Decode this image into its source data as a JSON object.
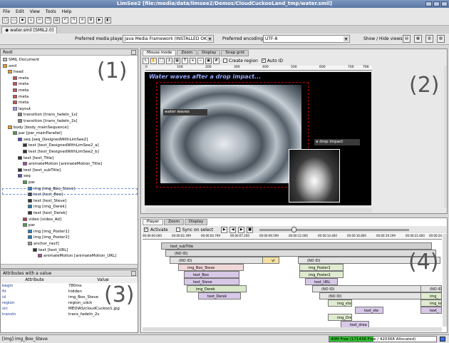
{
  "window": {
    "title": "LimSee2 [file:/media/data/limsee2/Demos/CloudCuckooLand_tmp/water.smil]"
  },
  "menu": [
    "File",
    "Edit",
    "View",
    "Tools",
    "Help"
  ],
  "toolbar_icons": [
    "new-icon",
    "open-icon",
    "save-icon",
    "saveas-icon",
    "cut-icon",
    "copy-icon",
    "paste-icon",
    "undo-icon",
    "redo-icon",
    "delete-icon",
    "settings-icon",
    "play-icon",
    "preview-icon"
  ],
  "document_tab": "water.smil [SMIL2.0]",
  "prefs": {
    "player_label": "Preferred media player:",
    "player_value": "Java Media Framework (INSTALLED OK)",
    "encoding_label": "Preferred encoding:",
    "encoding_value": "UTF-8",
    "views_label": "Show / Hide views:"
  },
  "tree": {
    "root_label": "Root",
    "rows": [
      "SMIL Document",
      "smil",
      "head",
      "meta",
      "meta",
      "meta",
      "meta",
      "meta",
      "layout",
      "transition [trans_fadeIn_1s]",
      "transition [trans_fadeIn_2s]",
      "body [body_mainSequence]",
      "par [par_mainParallel]",
      "seq [seq_DesignedWithLimSee2]",
      "text [text_DesignedWithLimSee2_a]",
      "text [text_DesignedWithLimSee2_b]",
      "text [text_Title]",
      "animateMotion [animateMotion_Title]",
      "text [text_subTitle]",
      "seq",
      "par",
      "img [img_Boo_Steve]",
      "text [text_Boo]",
      "text [text_Steve]",
      "img [img_Derek]",
      "text [text_Derek]",
      "video [video_Ad]",
      "par",
      "img [img_Poster1]",
      "img [img_Poster2]",
      "anchor_necf]",
      "text [text_URL]",
      "animateMotion [animateMotion_URL]"
    ]
  },
  "attributes": {
    "header": "Attributes with a value",
    "col_attr": "Attribute",
    "col_value": "Value",
    "rows": [
      {
        "k": "begin",
        "v": "780ms"
      },
      {
        "k": "fit",
        "v": "hidden"
      },
      {
        "k": "id",
        "v": "img_Boo_Steve"
      },
      {
        "k": "region",
        "v": "region_udck"
      },
      {
        "k": "src",
        "v": "MEDIAS/cloudCuckoo1.jpg"
      },
      {
        "k": "transIn",
        "v": "trans_fadeIn_2s"
      }
    ]
  },
  "layout_view": {
    "tabs": [
      "Mouse mode",
      "Zoom",
      "Display",
      "Snap grid"
    ],
    "create_region": "Create region",
    "auto_id": "Auto ID",
    "ruler": [
      "0",
      "100",
      "200",
      "300",
      "400",
      "500",
      "600",
      "700",
      "766"
    ],
    "title_text": "Water waves after a drop impact...",
    "label_water": "water waves",
    "label_drop": "a drop impact"
  },
  "timeline": {
    "tabs": [
      "Player",
      "Zoom",
      "Display"
    ],
    "activate": "Activate",
    "sync": "Sync on select",
    "ruler": [
      "00:00:00.000",
      "00:00:02.399",
      "00:00:04.799",
      "00:00:07.200",
      "00:00:09.599",
      "00:00:12.000",
      "00:00:14.400",
      "00:00:16.800",
      "00:00:19.199",
      "00:00:21.600",
      "00:00:24.0"
    ],
    "items": [
      {
        "label": "text_subTitle"
      },
      {
        "label": "(NO ID)"
      },
      {
        "label": "(NO ID)"
      },
      {
        "label": "img_Boo_Steve"
      },
      {
        "label": "text_Boo"
      },
      {
        "label": "text_Steve"
      },
      {
        "label": "img_Derek"
      },
      {
        "label": "text_Derek"
      },
      {
        "label": "vi"
      },
      {
        "label": "(NO ID)"
      },
      {
        "label": "img_Poster1"
      },
      {
        "label": "img_Poster2"
      },
      {
        "label": "text_URL"
      },
      {
        "label": "(NO ID)"
      },
      {
        "label": "(NO ID)"
      },
      {
        "label": "img_stoo"
      },
      {
        "label": "text_ste"
      },
      {
        "label": "img_Drea"
      },
      {
        "label": "text_drea"
      },
      {
        "label": "img_ken"
      },
      {
        "label": "text_"
      },
      {
        "label": "(NO ID)"
      },
      {
        "label": "img_"
      }
    ]
  },
  "panel_numbers": [
    "(1)",
    "(2)",
    "(3)",
    "(4)"
  ],
  "status": {
    "left": "[img] img_Boo_Steve",
    "memory": "40M Free (171436 Free / 420368 Allocated)",
    "memory_fraction": 0.41
  },
  "colors": {
    "title_bar": "#6a85b0",
    "memory_bar": "#2fbf2f",
    "stage_bg": "#000000",
    "caption_text": "#9aa8ff"
  }
}
